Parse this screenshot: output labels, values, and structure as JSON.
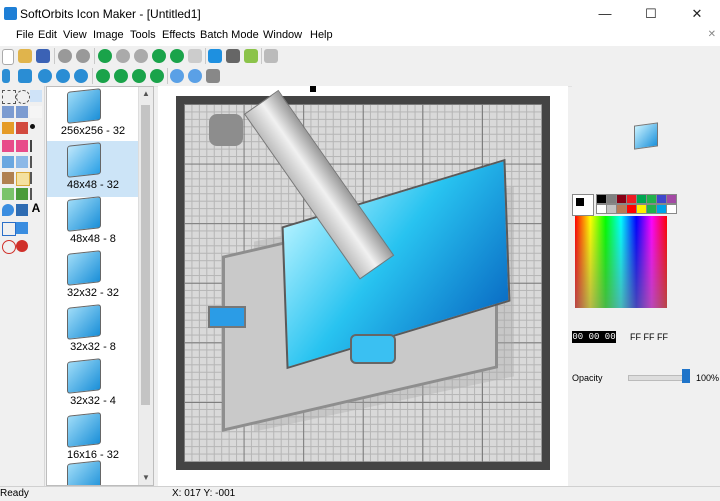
{
  "window": {
    "title": "SoftOrbits Icon Maker - [Untitled1]",
    "controls": {
      "minimize": "—",
      "maximize": "☐",
      "close": "✕"
    }
  },
  "menu": {
    "items": [
      "File",
      "Edit",
      "View",
      "Image",
      "Tools",
      "Effects",
      "Batch Mode",
      "Window",
      "Help"
    ],
    "close_glyph": "✕"
  },
  "toolbar1": {
    "icons": [
      "new-file-icon",
      "open-folder-icon",
      "save-icon",
      "gray-circle-icon",
      "gray-circle-icon",
      "green-down-icon",
      "green-up-icon",
      "gray-box-icon",
      "gray-box-icon",
      "windows-icon",
      "apple-icon",
      "android-icon",
      "settings-icon"
    ]
  },
  "toolbar2": {
    "icons": [
      "resize-vertical-icon",
      "resize-horizontal-icon",
      "rotate-icon",
      "rotate-icon",
      "rotate-icon",
      "rotate-icon",
      "green-left-icon",
      "green-right-icon",
      "green-up-icon",
      "green-down-icon",
      "zoom-in-icon",
      "zoom-out-icon",
      "stop-icon"
    ]
  },
  "thumbnails": [
    {
      "label": "256x256 - 32"
    },
    {
      "label": "48x48 - 32"
    },
    {
      "label": "48x48 - 8"
    },
    {
      "label": "32x32 - 32"
    },
    {
      "label": "32x32 - 8"
    },
    {
      "label": "32x32 - 4"
    },
    {
      "label": "16x16 - 32"
    }
  ],
  "selected_thumbnail": 1,
  "color_panel": {
    "foreground_hex": "00 00 00",
    "background_hex": "FF FF FF",
    "opacity_label": "Opacity",
    "opacity_value": "100%",
    "swatches": [
      "#000000",
      "#7f7f7f",
      "#880015",
      "#ed1c24",
      "#00a651",
      "#22b14c",
      "#3f48cc",
      "#a349a4",
      "#ffffff",
      "#c3c3c3",
      "#b97a57",
      "#ff0000",
      "#fff200",
      "#22b14c",
      "#00a2e8",
      "#ffffff"
    ]
  },
  "status": {
    "left": "Ready",
    "coordinates": "X: 017 Y: -001"
  }
}
